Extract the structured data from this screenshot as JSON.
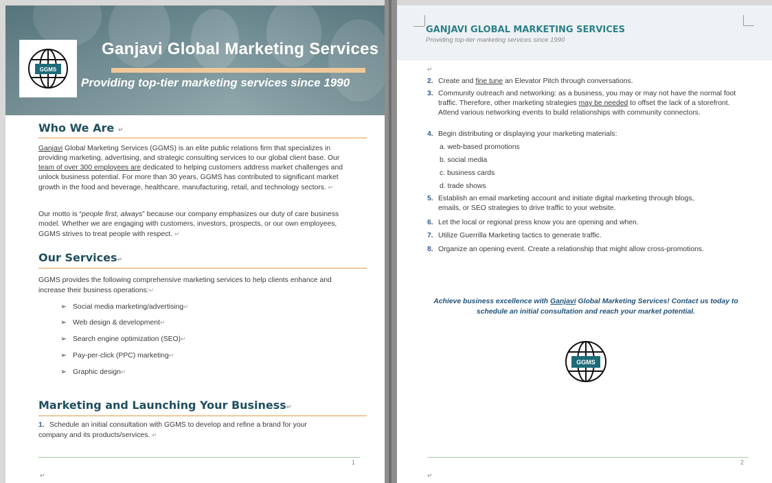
{
  "page1": {
    "banner": {
      "title": "Ganjavi Global Marketing Services",
      "subtitle": "Providing top-tier marketing services since 1990",
      "logo_text": "GGMS"
    },
    "who": {
      "heading": "Who We Are",
      "p1_a": "Ganjavi",
      "p1_b": " Global Marketing Services (GGMS) is an elite public relations firm that specializes in providing marketing, advertising, and strategic consulting services to our global client base. Our ",
      "p1_c": "team of over 300 employees are",
      "p1_d": " dedicated to helping customers address market challenges and unlock business potential. For more than 30 years, GGMS has contributed to significant market growth in the food and beverage, healthcare, manufacturing, retail, and technology sectors.",
      "p2_a": "Our motto is “",
      "p2_b": "people first, always",
      "p2_c": "” because our company emphasizes our duty of care business model. Whether we are engaging with customers, investors, prospects, or our own employees, GGMS strives to treat people with respect."
    },
    "services": {
      "heading": "Our Services",
      "intro": "GGMS provides the following comprehensive marketing services to help clients enhance and increase their business operations:",
      "items": [
        "Social media marketing/advertising",
        "Web design & development",
        "Search engine optimization (SEO)",
        "Pay-per-click (PPC) marketing",
        "Graphic design"
      ]
    },
    "launch": {
      "heading": "Marketing and Launching Your Business",
      "item1_num": "1.",
      "item1_text": "Schedule an initial consultation with GGMS to develop and refine a brand for your company and its products/services."
    },
    "page_number": "1"
  },
  "page2": {
    "header_title": "GANJAVI GLOBAL MARKETING SERVICES",
    "header_sub": "Providing top-tier marketing services since 1990",
    "items": [
      {
        "num": "2.",
        "text_a": "Create and ",
        "text_u": "fine tune",
        "text_b": " an Elevator Pitch through conversations."
      },
      {
        "num": "3.",
        "text_a": "Community outreach and networking: as a business, you may or may not have the normal foot traffic. Therefore, other marketing strategies ",
        "text_u": "may be needed",
        "text_b": " to offset the lack of a storefront. Attend various networking events to build relationships with community connectors."
      },
      {
        "num": "4.",
        "text_a": "Begin distributing or displaying your marketing materials:",
        "text_u": "",
        "text_b": ""
      },
      {
        "num": "5.",
        "text_a": "Establish an email marketing account and initiate digital marketing through blogs, emails, or SEO strategies to drive traffic to your website.",
        "text_u": "",
        "text_b": ""
      },
      {
        "num": "6.",
        "text_a": "Let the local or regional press know you are opening and when.",
        "text_u": "",
        "text_b": ""
      },
      {
        "num": "7.",
        "text_a": "Utilize Guerrilla Marketing tactics to generate traffic.",
        "text_u": "",
        "text_b": ""
      },
      {
        "num": "8.",
        "text_a": "Organize an opening event. Create a relationship that might allow cross-promotions.",
        "text_u": "",
        "text_b": ""
      }
    ],
    "subitems": [
      "a.  web-based promotions",
      "b.  social media",
      "c.  business cards",
      "d.  trade shows"
    ],
    "cta_a": "Achieve business excellence with ",
    "cta_u": "Ganjavi",
    "cta_b": " Global Marketing Services! Contact us today to schedule an initial consultation and reach your market potential.",
    "logo_text": "GGMS",
    "page_number": "2"
  },
  "colors": {
    "heading": "#1f4f5d",
    "accent_rule": "#f0c89a",
    "number": "#2e5c8a",
    "cta": "#22537a",
    "logo_fill": "#1d6b78"
  }
}
